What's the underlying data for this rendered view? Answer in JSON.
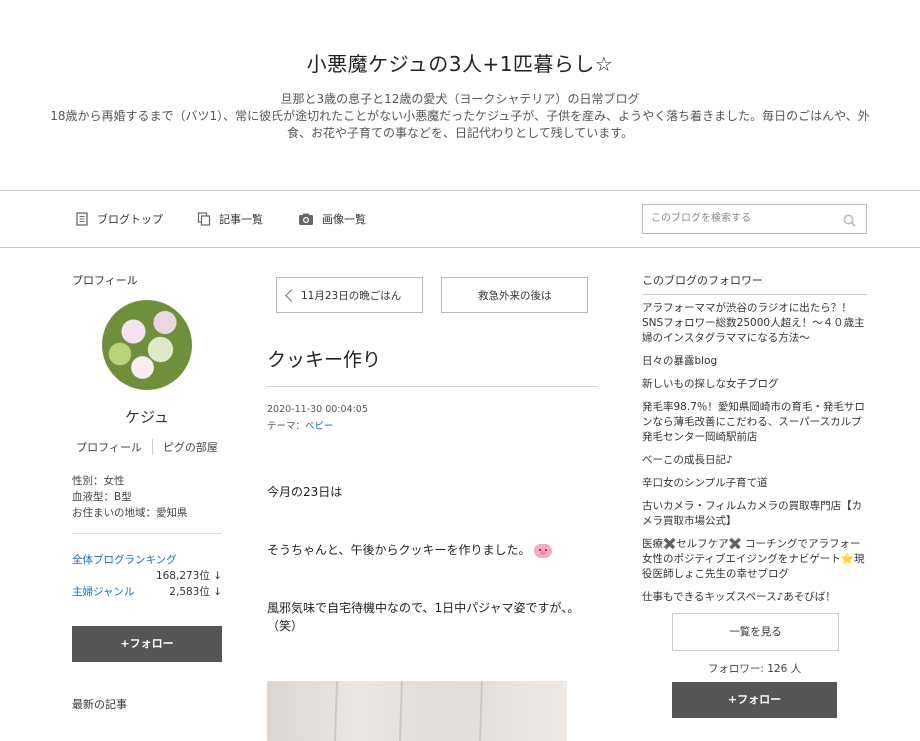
{
  "header": {
    "title": "小悪魔ケジュの3人+1匹暮らし☆",
    "subtitle": "旦那と3歳の息子と12歳の愛犬（ヨークシャテリア）の日常ブログ",
    "description": "18歳から再婚するまで（バツ1）、常に彼氏が途切れたことがない小悪魔だったケジュ子が、子供を産み、ようやく落ち着きました。毎日のごはんや、外食、お花や子育ての事などを、日記代わりとして残しています。"
  },
  "nav": {
    "blog_top": "ブログトップ",
    "articles": "記事一覧",
    "images": "画像一覧",
    "search_placeholder": "このブログを検索する"
  },
  "profile": {
    "heading": "プロフィール",
    "name": "ケジュ",
    "link_profile": "プロフィール",
    "link_room": "ピグの部屋",
    "gender": "性別：女性",
    "blood": "血液型：B型",
    "area": "お住まいの地域：愛知県",
    "rank_all_label": "全体ブログランキング",
    "rank_all_value": "168,273位 ↓",
    "rank_genre_label": "主婦ジャンル",
    "rank_genre_value": "2,583位 ↓",
    "follow_button": "+フォロー",
    "latest_heading": "最新の記事"
  },
  "post": {
    "prev_label": "11月23日の晩ごはん",
    "next_label": "救急外来の後は",
    "title": "クッキー作り",
    "date": "2020-11-30 00:04:05",
    "theme_label": "テーマ：",
    "theme_value": "ベビー",
    "para1": "今月の23日は",
    "para2": "そうちゃんと、午後からクッキーを作りました。",
    "para3": "風邪気味で自宅待機中なので、1日中パジャマ姿ですが、。（笑）"
  },
  "followers": {
    "heading": "このブログのフォロワー",
    "items": [
      "アラフォーママが渋谷のラジオに出たら？！SNSフォロワー総数25000人超え！〜４０歳主婦のインスタグラママになる方法〜",
      "日々の暴露blog",
      "新しいもの探しな女子ブログ",
      "発毛率98.7％！愛知県岡崎市の育毛・発毛サロンなら薄毛改善にこだわる、スーパースカルプ発毛センター岡崎駅前店",
      "べーこの成長日記♪",
      "辛口女のシンプル子育て道",
      "古いカメラ・フィルムカメラの買取専門店【カメラ買取市場公式】",
      "医療✖️セルフケア✖️ コーチングでアラフォー女性のポジティブエイジングをナビゲート⭐️現役医師しょこ先生の幸せブログ",
      "仕事もできるキッズスペース♪あそびば！"
    ],
    "see_all": "一覧を見る",
    "count": "フォロワー: 126 人",
    "follow_button": "+フォロー"
  }
}
